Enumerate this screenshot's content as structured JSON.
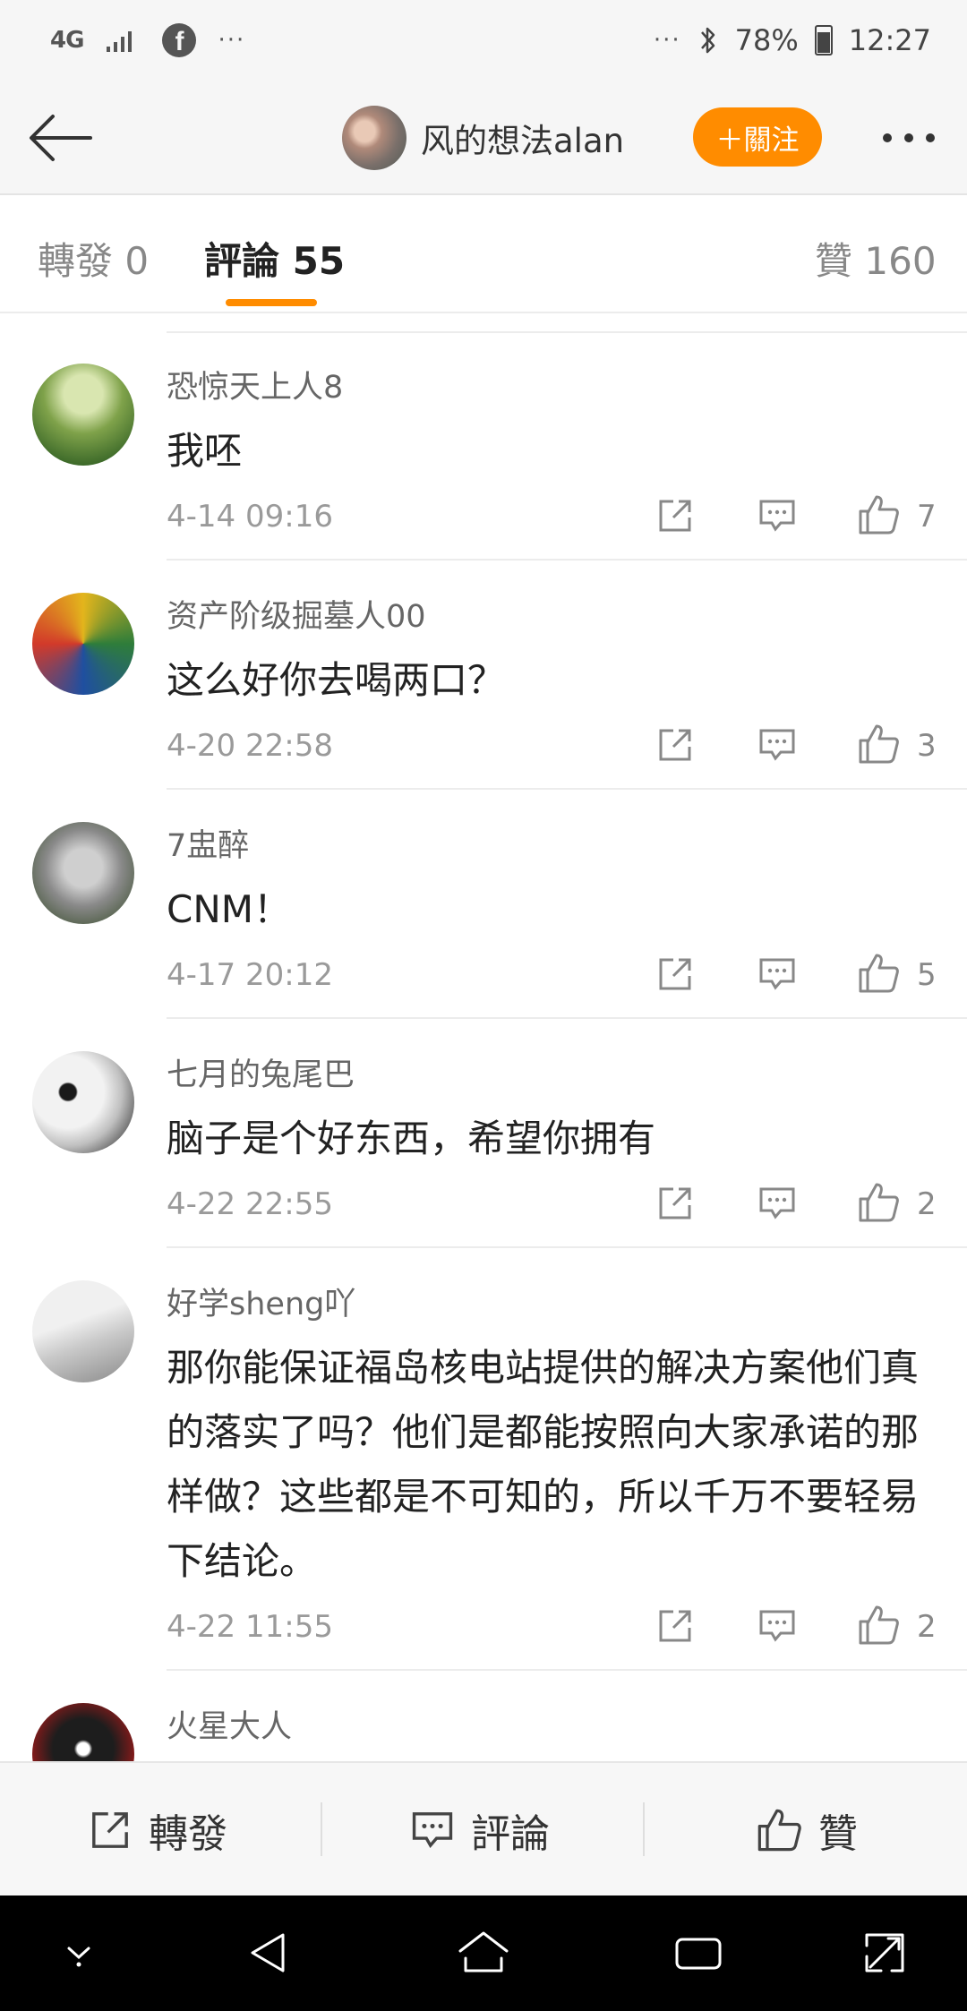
{
  "status_bar": {
    "network": "4G",
    "overflow": "···",
    "more": "···",
    "battery": "78%",
    "time": "12:27",
    "icons": [
      "signal-icon",
      "facebook-icon",
      "bluetooth-icon",
      "battery-icon"
    ]
  },
  "header": {
    "user_name": "风的想法alan",
    "follow_label": "＋關注"
  },
  "tabs": [
    {
      "label": "轉發",
      "count": "0"
    },
    {
      "label": "評論",
      "count": "55"
    },
    {
      "label": "贊",
      "count": "160"
    }
  ],
  "comments": [
    {
      "name": "恐惊天上人8",
      "text": "我呸",
      "time": "4-14 09:16",
      "likes": "7"
    },
    {
      "name": "资产阶级掘墓人00",
      "text": "这么好你去喝两口？",
      "time": "4-20 22:58",
      "likes": "3"
    },
    {
      "name": "7盅醉",
      "text": "CNM！",
      "time": "4-17 20:12",
      "likes": "5"
    },
    {
      "name": "七月的兔尾巴",
      "text": "脑子是个好东西，希望你拥有",
      "time": "4-22 22:55",
      "likes": "2"
    },
    {
      "name": "好学sheng吖",
      "text": "那你能保证福岛核电站提供的解决方案他们真的落实了吗？他们是都能按照向大家承诺的那样做？这些都是不可知的，所以千万不要轻易下结论。",
      "time": "4-22 11:55",
      "likes": "2"
    },
    {
      "name": "火星大人",
      "text": "",
      "time": "",
      "likes": ""
    }
  ],
  "bottom_bar": {
    "repost_label": "轉發",
    "comment_label": "評論",
    "like_label": "贊"
  },
  "colors": {
    "accent": "#ff8c00",
    "background": "#ffffff",
    "bar_background": "#f6f6f6"
  }
}
